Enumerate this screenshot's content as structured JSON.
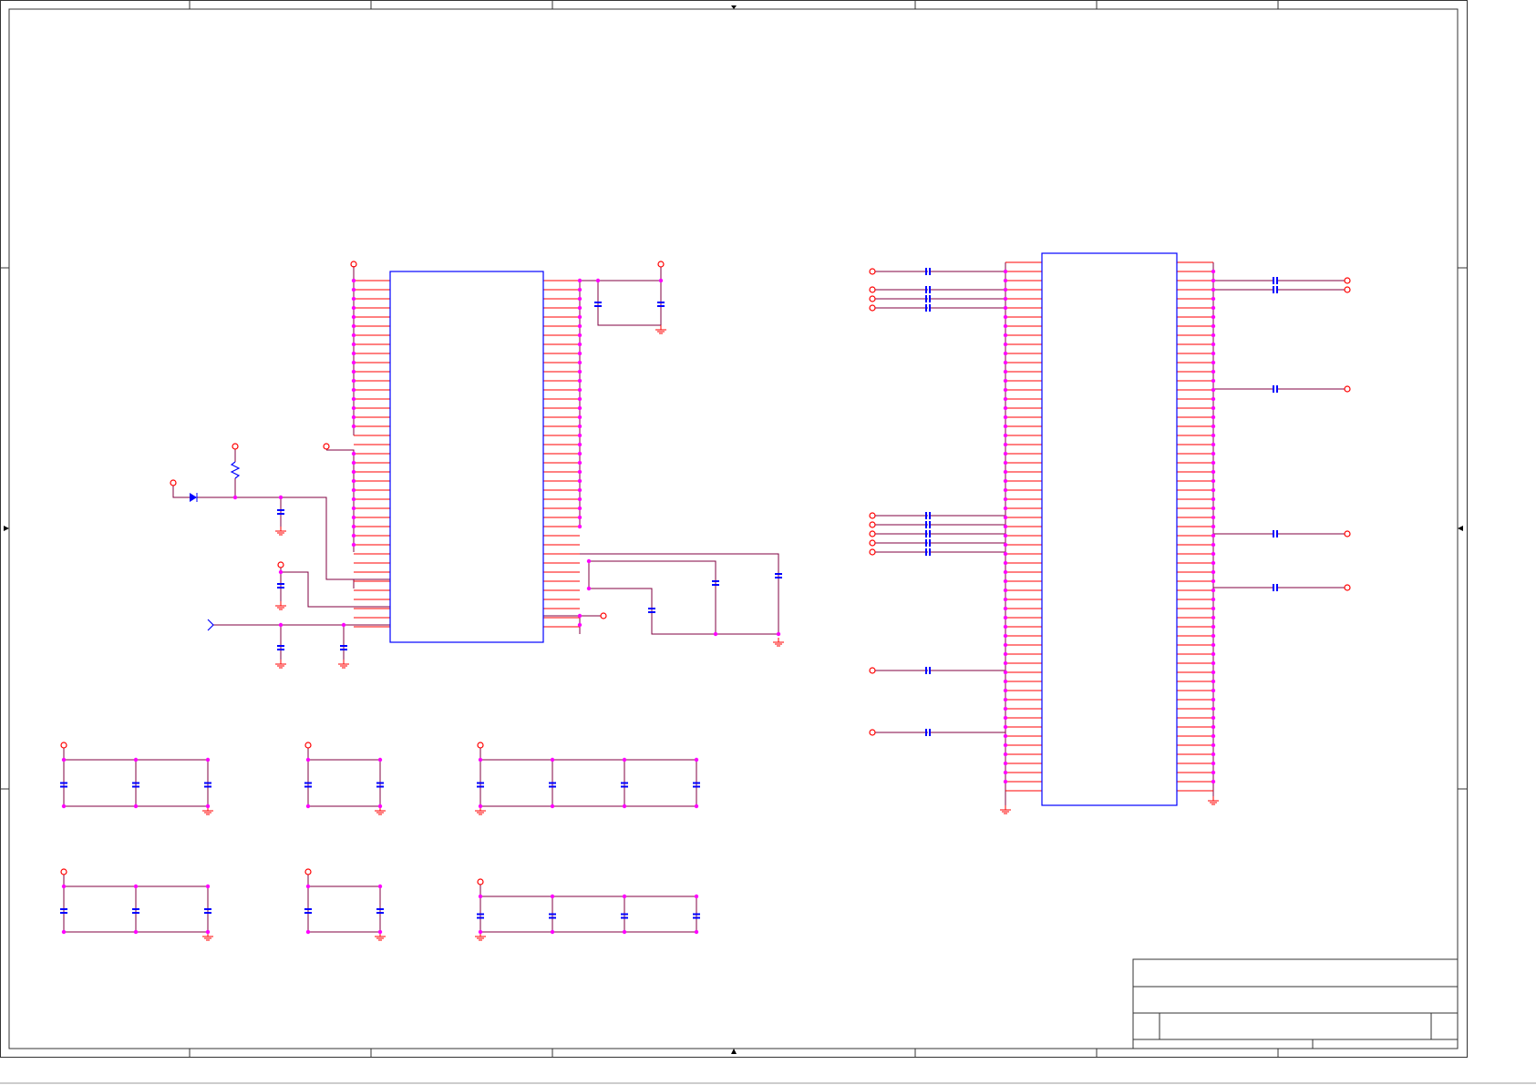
{
  "sheet": {
    "background": "#ffffff",
    "border_color": "#333333",
    "wire_color": "#800040",
    "pin_color": "#ff0000",
    "component_color": "#0000ff",
    "junction_color": "#ff00ff",
    "power_symbol_color": "#ff0000",
    "ground_symbol_color": "#ff0000"
  },
  "symbols": {
    "ic_left": "ic-body",
    "ic_right": "ic-body",
    "capacitor": "capacitor-icon",
    "resistor": "resistor-icon",
    "diode": "diode-icon",
    "power_port": "power-port-icon",
    "ground": "ground-icon",
    "input_port": "input-port-icon"
  },
  "title_block": {
    "cells": [
      "",
      "",
      "",
      "",
      ""
    ]
  }
}
